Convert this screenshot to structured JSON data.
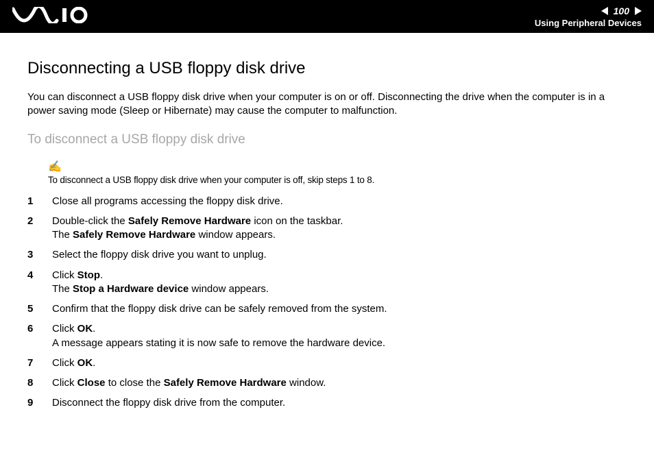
{
  "header": {
    "page_number": "100",
    "section_title": "Using Peripheral Devices"
  },
  "content": {
    "title": "Disconnecting a USB floppy disk drive",
    "intro": "You can disconnect a USB floppy disk drive when your computer is on or off. Disconnecting the drive when the computer is in a power saving mode (Sleep or Hibernate) may cause the computer to malfunction.",
    "subtitle": "To disconnect a USB floppy disk drive",
    "note_icon": "✍",
    "note": "To disconnect a USB floppy disk drive when your computer is off, skip steps 1 to 8.",
    "steps": [
      {
        "n": "1",
        "text_pre": "Close all programs accessing the floppy disk drive."
      },
      {
        "n": "2",
        "text_pre": "Double-click the ",
        "bold1": "Safely Remove Hardware",
        "text_mid": " icon on the taskbar.",
        "br": true,
        "text_line2_pre": "The ",
        "bold2": "Safely Remove Hardware",
        "text_line2_post": " window appears."
      },
      {
        "n": "3",
        "text_pre": "Select the floppy disk drive you want to unplug."
      },
      {
        "n": "4",
        "text_pre": "Click ",
        "bold1": "Stop",
        "text_mid": ".",
        "br": true,
        "text_line2_pre": "The ",
        "bold2": "Stop a Hardware device",
        "text_line2_post": " window appears."
      },
      {
        "n": "5",
        "text_pre": "Confirm that the floppy disk drive can be safely removed from the system."
      },
      {
        "n": "6",
        "text_pre": "Click ",
        "bold1": "OK",
        "text_mid": ".",
        "br": true,
        "text_line2_pre": "A message appears stating it is now safe to remove the hardware device."
      },
      {
        "n": "7",
        "text_pre": "Click ",
        "bold1": "OK",
        "text_mid": "."
      },
      {
        "n": "8",
        "text_pre": "Click ",
        "bold1": "Close",
        "text_mid": " to close the ",
        "bold2": "Safely Remove Hardware",
        "text_post": " window."
      },
      {
        "n": "9",
        "text_pre": "Disconnect the floppy disk drive from the computer."
      }
    ]
  }
}
